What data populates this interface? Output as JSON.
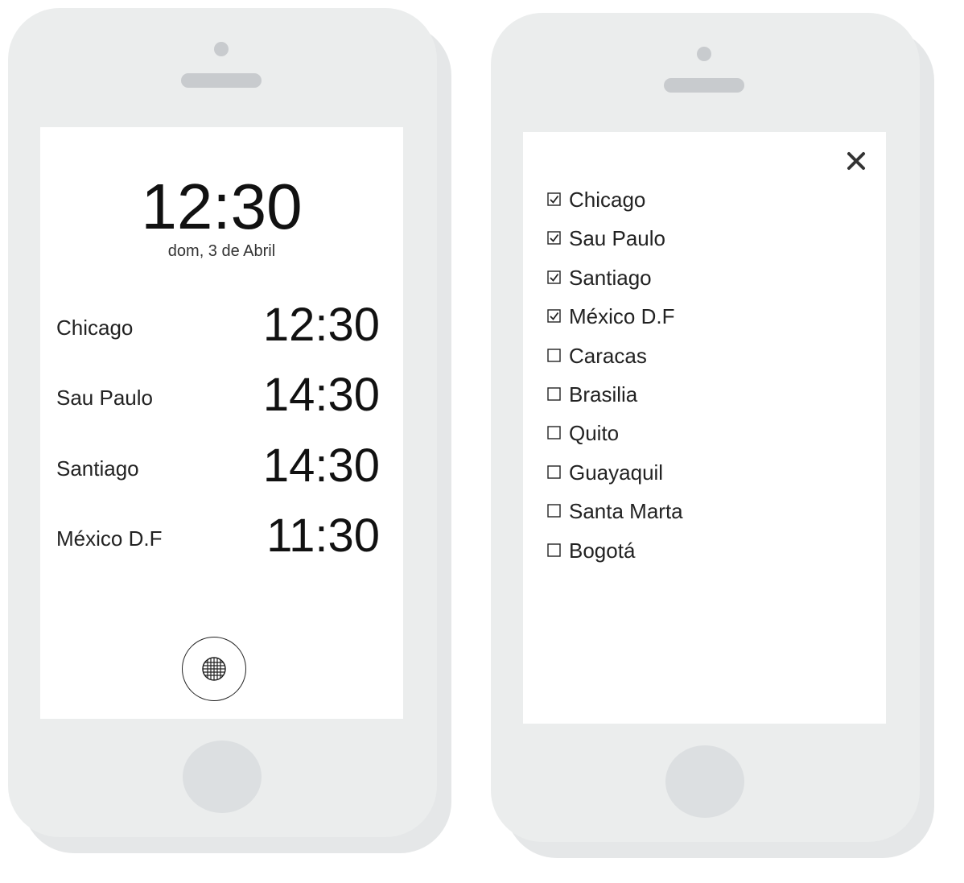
{
  "left_screen": {
    "main_time": "12:30",
    "main_date": "dom, 3 de Abril",
    "cities": [
      {
        "name": "Chicago",
        "time": "12:30"
      },
      {
        "name": "Sau Paulo",
        "time": "14:30"
      },
      {
        "name": "Santiago",
        "time": "14:30"
      },
      {
        "name": "México D.F",
        "time": "11:30"
      }
    ],
    "globe_icon": "globe-icon"
  },
  "right_screen": {
    "close_icon": "close-icon",
    "options": [
      {
        "label": "Chicago",
        "checked": true
      },
      {
        "label": "Sau Paulo",
        "checked": true
      },
      {
        "label": "Santiago",
        "checked": true
      },
      {
        "label": "México D.F",
        "checked": true
      },
      {
        "label": "Caracas",
        "checked": false
      },
      {
        "label": "Brasilia",
        "checked": false
      },
      {
        "label": "Quito",
        "checked": false
      },
      {
        "label": "Guayaquil",
        "checked": false
      },
      {
        "label": "Santa Marta",
        "checked": false
      },
      {
        "label": "Bogotá",
        "checked": false
      }
    ]
  },
  "colors": {
    "phone_body": "#ebeded",
    "phone_shadow": "#e5e7e8",
    "hardware": "#c8cbce",
    "home_button": "#dcdfe1",
    "screen": "#ffffff",
    "text": "#111111"
  }
}
